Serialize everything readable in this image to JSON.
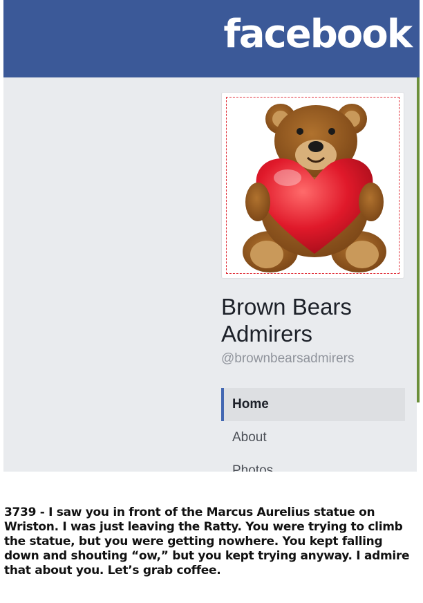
{
  "header": {
    "logo_text": "facebook",
    "brand_color": "#3b5998"
  },
  "page": {
    "name": "Brown Bears Admirers",
    "handle": "@brownbearsadmirers",
    "profile_image": "teddy-bear-holding-heart"
  },
  "nav": {
    "items": [
      {
        "label": "Home",
        "active": true
      },
      {
        "label": "About",
        "active": false
      },
      {
        "label": "Photos",
        "active": false
      }
    ]
  },
  "post": {
    "text": "3739 - I saw you in front of the Marcus Aurelius statue on Wriston. I was just leaving the Ratty. You were trying to climb the statue, but you were getting nowhere. You kept falling down and shouting “ow,” but you kept trying anyway. I admire that about you. Let’s grab coffee."
  }
}
